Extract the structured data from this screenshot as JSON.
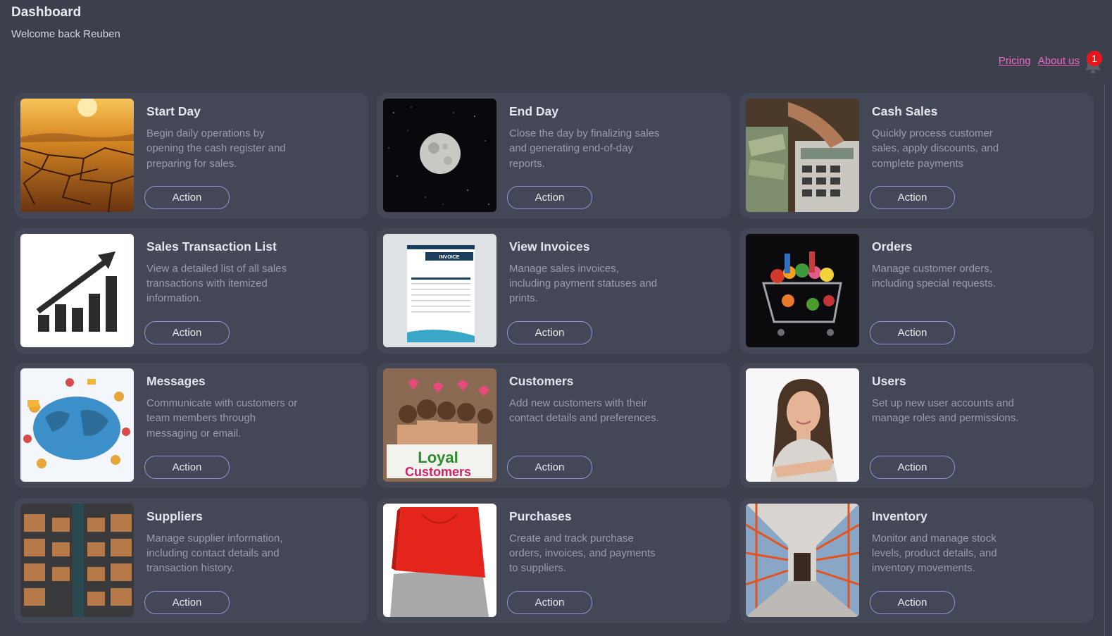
{
  "header": {
    "title": "Dashboard",
    "subtitle": "Welcome back Reuben"
  },
  "nav": {
    "pricing": "Pricing",
    "about": "About us",
    "notification_count": "1"
  },
  "cards": [
    {
      "title": "Start Day",
      "description": "Begin daily operations by opening the cash register and preparing for sales.",
      "action": "Action",
      "image": "cracked-desert-sunset"
    },
    {
      "title": "End Day",
      "description": "Close the day by finalizing sales and generating end-of-day reports.",
      "action": "Action",
      "image": "full-moon-night-sky"
    },
    {
      "title": "Cash Sales",
      "description": "Quickly process customer sales, apply discounts, and complete payments",
      "action": "Action",
      "image": "cash-calculator"
    },
    {
      "title": "Sales Transaction List",
      "description": "View a detailed list of all sales transactions with itemized information.",
      "action": "Action",
      "image": "growth-bar-chart"
    },
    {
      "title": "View Invoices",
      "description": "Manage sales invoices, including payment statuses and prints.",
      "action": "Action",
      "image": "invoice-document"
    },
    {
      "title": "Orders",
      "description": "Manage customer orders, including special requests.",
      "action": "Action",
      "image": "shopping-cart-groceries"
    },
    {
      "title": "Messages",
      "description": "Communicate with customers or team members through messaging or email.",
      "action": "Action",
      "image": "global-network-people"
    },
    {
      "title": "Customers",
      "description": "Add new customers with their contact details and preferences.",
      "action": "Action",
      "image": "loyal-customers-group"
    },
    {
      "title": "Users",
      "description": "Set up new user accounts and manage roles and permissions.",
      "action": "Action",
      "image": "smiling-woman-portrait"
    },
    {
      "title": "Suppliers",
      "description": "Manage supplier information, including contact details and transaction history.",
      "action": "Action",
      "image": "warehouse-boxes"
    },
    {
      "title": "Purchases",
      "description": "Create and track purchase orders, invoices, and payments to suppliers.",
      "action": "Action",
      "image": "red-shopping-bag"
    },
    {
      "title": "Inventory",
      "description": "Monitor and manage stock levels, product details, and inventory movements.",
      "action": "Action",
      "image": "warehouse-aisle-shelves"
    }
  ],
  "image_text": {
    "loyal_banner_1": "Loyal",
    "loyal_banner_2": "Customers",
    "invoice_heading": "INVOICE"
  },
  "colors": {
    "background": "#3c3f4c",
    "card": "#444756",
    "link": "#f067c3",
    "button_border": "#8f95d8",
    "badge": "#e8161c"
  }
}
